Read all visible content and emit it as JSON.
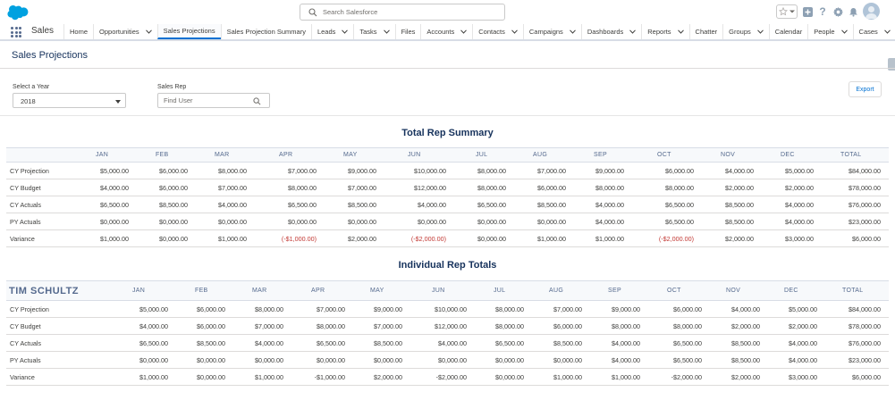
{
  "header": {
    "search_placeholder": "Search Salesforce"
  },
  "nav": {
    "app_name": "Sales",
    "items": [
      {
        "label": "Home",
        "chevron": false,
        "active": false
      },
      {
        "label": "Opportunities",
        "chevron": true,
        "active": false
      },
      {
        "label": "Sales Projections",
        "chevron": false,
        "active": true
      },
      {
        "label": "Sales Projection Summary",
        "chevron": false,
        "active": false
      },
      {
        "label": "Leads",
        "chevron": true,
        "active": false
      },
      {
        "label": "Tasks",
        "chevron": true,
        "active": false
      },
      {
        "label": "Files",
        "chevron": false,
        "active": false
      },
      {
        "label": "Accounts",
        "chevron": true,
        "active": false
      },
      {
        "label": "Contacts",
        "chevron": true,
        "active": false
      },
      {
        "label": "Campaigns",
        "chevron": true,
        "active": false
      },
      {
        "label": "Dashboards",
        "chevron": true,
        "active": false
      },
      {
        "label": "Reports",
        "chevron": true,
        "active": false
      },
      {
        "label": "Chatter",
        "chevron": false,
        "active": false
      },
      {
        "label": "Groups",
        "chevron": true,
        "active": false
      },
      {
        "label": "Calendar",
        "chevron": false,
        "active": false
      },
      {
        "label": "People",
        "chevron": true,
        "active": false
      },
      {
        "label": "Cases",
        "chevron": true,
        "active": false
      },
      {
        "label": "Forecasts",
        "chevron": false,
        "active": false
      }
    ]
  },
  "page": {
    "title": "Sales Projections",
    "year_label": "Select a Year",
    "year_value": "2018",
    "rep_label": "Sales Rep",
    "rep_placeholder": "Find User",
    "export_label": "Export"
  },
  "colors": {
    "accent": "#0070d2",
    "title": "#16325c",
    "negative": "#c23934"
  },
  "summary": {
    "title": "Total Rep Summary",
    "columns": [
      "",
      "JAN",
      "FEB",
      "MAR",
      "APR",
      "MAY",
      "JUN",
      "JUL",
      "AUG",
      "SEP",
      "OCT",
      "NOV",
      "DEC",
      "TOTAL"
    ],
    "rows": [
      {
        "cells": [
          "CY Projection",
          "$5,000.00",
          "$6,000.00",
          "$8,000.00",
          "$7,000.00",
          "$9,000.00",
          "$10,000.00",
          "$8,000.00",
          "$7,000.00",
          "$9,000.00",
          "$6,000.00",
          "$4,000.00",
          "$5,000.00",
          "$84,000.00"
        ]
      },
      {
        "cells": [
          "CY Budget",
          "$4,000.00",
          "$6,000.00",
          "$7,000.00",
          "$8,000.00",
          "$7,000.00",
          "$12,000.00",
          "$8,000.00",
          "$6,000.00",
          "$8,000.00",
          "$8,000.00",
          "$2,000.00",
          "$2,000.00",
          "$78,000.00"
        ]
      },
      {
        "cells": [
          "CY Actuals",
          "$6,500.00",
          "$8,500.00",
          "$4,000.00",
          "$6,500.00",
          "$8,500.00",
          "$4,000.00",
          "$6,500.00",
          "$8,500.00",
          "$4,000.00",
          "$6,500.00",
          "$8,500.00",
          "$4,000.00",
          "$76,000.00"
        ]
      },
      {
        "cells": [
          "PY Actuals",
          "$0,000.00",
          "$0,000.00",
          "$0,000.00",
          "$0,000.00",
          "$0,000.00",
          "$0,000.00",
          "$0,000.00",
          "$0,000.00",
          "$4,000.00",
          "$6,500.00",
          "$8,500.00",
          "$4,000.00",
          "$23,000.00"
        ]
      },
      {
        "cells": [
          "Variance",
          "$1,000.00",
          "$0,000.00",
          "$1,000.00",
          "(-$1,000.00)",
          "$2,000.00",
          "(-$2,000.00)",
          "$0,000.00",
          "$1,000.00",
          "$1,000.00",
          "(-$2,000.00)",
          "$2,000.00",
          "$3,000.00",
          "$6,000.00"
        ]
      }
    ]
  },
  "individual": {
    "title": "Individual Rep Totals",
    "rep_name": "TIM SCHULTZ",
    "columns": [
      "JAN",
      "FEB",
      "MAR",
      "APR",
      "MAY",
      "JUN",
      "JUL",
      "AUG",
      "SEP",
      "OCT",
      "NOV",
      "DEC",
      "TOTAL"
    ],
    "rows": [
      {
        "cells": [
          "CY Projection",
          "$5,000.00",
          "$6,000.00",
          "$8,000.00",
          "$7,000.00",
          "$9,000.00",
          "$10,000.00",
          "$8,000.00",
          "$7,000.00",
          "$9,000.00",
          "$6,000.00",
          "$4,000.00",
          "$5,000.00",
          "$84,000.00"
        ]
      },
      {
        "cells": [
          "CY Budget",
          "$4,000.00",
          "$6,000.00",
          "$7,000.00",
          "$8,000.00",
          "$7,000.00",
          "$12,000.00",
          "$8,000.00",
          "$6,000.00",
          "$8,000.00",
          "$8,000.00",
          "$2,000.00",
          "$2,000.00",
          "$78,000.00"
        ]
      },
      {
        "cells": [
          "CY Actuals",
          "$6,500.00",
          "$8,500.00",
          "$4,000.00",
          "$6,500.00",
          "$8,500.00",
          "$4,000.00",
          "$6,500.00",
          "$8,500.00",
          "$4,000.00",
          "$6,500.00",
          "$8,500.00",
          "$4,000.00",
          "$76,000.00"
        ]
      },
      {
        "cells": [
          "PY Actuals",
          "$0,000.00",
          "$0,000.00",
          "$0,000.00",
          "$0,000.00",
          "$0,000.00",
          "$0,000.00",
          "$0,000.00",
          "$0,000.00",
          "$4,000.00",
          "$6,500.00",
          "$8,500.00",
          "$4,000.00",
          "$23,000.00"
        ]
      },
      {
        "cells": [
          "Variance",
          "$1,000.00",
          "$0,000.00",
          "$1,000.00",
          "-$1,000.00",
          "$2,000.00",
          "-$2,000.00",
          "$0,000.00",
          "$1,000.00",
          "$1,000.00",
          "-$2,000.00",
          "$2,000.00",
          "$3,000.00",
          "$6,000.00"
        ]
      }
    ]
  }
}
